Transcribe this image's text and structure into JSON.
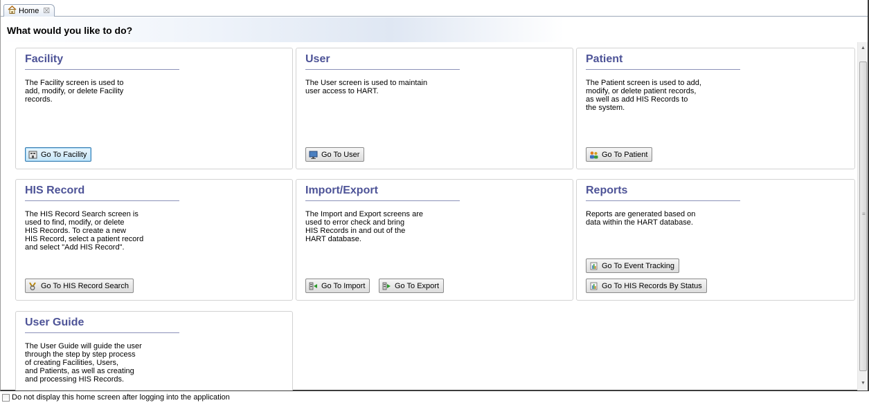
{
  "tab": {
    "label": "Home",
    "close_glyph": "☒",
    "icon": "house-icon"
  },
  "page_title": "What would you like to do?",
  "cards": {
    "facility": {
      "title": "Facility",
      "description": "The Facility screen is used to\nadd, modify, or delete Facility\nrecords.",
      "button": "Go To Facility",
      "button_icon": "facility-icon"
    },
    "user": {
      "title": "User",
      "description": "The User screen is used to maintain\nuser access to HART.",
      "button": "Go To User",
      "button_icon": "monitor-icon"
    },
    "patient": {
      "title": "Patient",
      "description": "The Patient screen is used to add,\nmodify, or delete patient records,\nas well as add HIS Records to\nthe system.",
      "button": "Go To Patient",
      "button_icon": "people-icon"
    },
    "his_record": {
      "title": "HIS Record",
      "description": "The HIS Record Search screen is\nused to find, modify, or delete\nHIS Records.  To create a new\nHIS Record, select a patient record\nand select \"Add HIS Record\".",
      "button": "Go To HIS Record Search",
      "button_icon": "search-records-icon"
    },
    "import_export": {
      "title": "Import/Export",
      "description": "The Import and Export screens are\nused to error check and bring\nHIS Records in and out of the\nHART database.",
      "button_import": "Go To Import",
      "button_export": "Go To Export",
      "import_icon": "import-icon",
      "export_icon": "export-icon"
    },
    "reports": {
      "title": "Reports",
      "description": "Reports are generated based on\ndata within the HART database.",
      "button_event": "Go To Event Tracking",
      "button_status": "Go To HIS Records By Status",
      "report_icon": "report-icon"
    },
    "user_guide": {
      "title": "User Guide",
      "description": "The User Guide will guide the user\nthrough the step by step process\nof creating Facilities, Users,\nand Patients, as well as creating\nand processing HIS Records."
    }
  },
  "footer": {
    "checkbox_label": "Do not display this home screen after logging into the application",
    "checked": false
  },
  "colors": {
    "title": "#4d5397",
    "rule": "#8a90b8",
    "focus": "#3c7fb1"
  }
}
